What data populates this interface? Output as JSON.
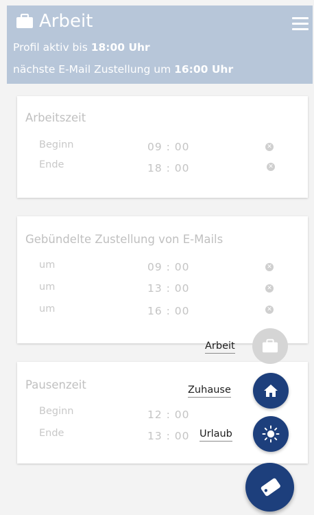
{
  "header": {
    "title": "Arbeit",
    "line1_prefix": "Profil aktiv bis ",
    "line1_value": "18:00 Uhr",
    "line2_prefix": "nächste E-Mail Zustellung um ",
    "line2_value": "16:00 Uhr",
    "icon": "briefcase-icon",
    "menu_icon": "hamburger-menu-icon"
  },
  "work_card": {
    "title": "Arbeitszeit",
    "rows": [
      {
        "label": "Beginn",
        "time": "09 : 00"
      },
      {
        "label": "Ende",
        "time": "18 : 00"
      }
    ]
  },
  "email_card": {
    "title": "Gebündelte Zustellung von E-Mails",
    "rows": [
      {
        "label": "um",
        "time": "09 : 00"
      },
      {
        "label": "um",
        "time": "13 : 00"
      },
      {
        "label": "um",
        "time": "16 : 00"
      }
    ]
  },
  "break_card": {
    "title": "Pausenzeit",
    "rows": [
      {
        "label": "Beginn",
        "time": "12 : 00"
      },
      {
        "label": "Ende",
        "time": "13 : 00"
      }
    ]
  },
  "fab_menu": {
    "items": [
      {
        "label": "Arbeit",
        "icon": "briefcase-icon"
      },
      {
        "label": "Zuhause",
        "icon": "home-icon"
      },
      {
        "label": "Urlaub",
        "icon": "sun-icon"
      }
    ],
    "main_icon": "luggage-tag-icon"
  },
  "colors": {
    "header_bg": "#b7c6d9",
    "accent": "#1d3f7c",
    "inactive_fab": "#d5d5d5"
  }
}
